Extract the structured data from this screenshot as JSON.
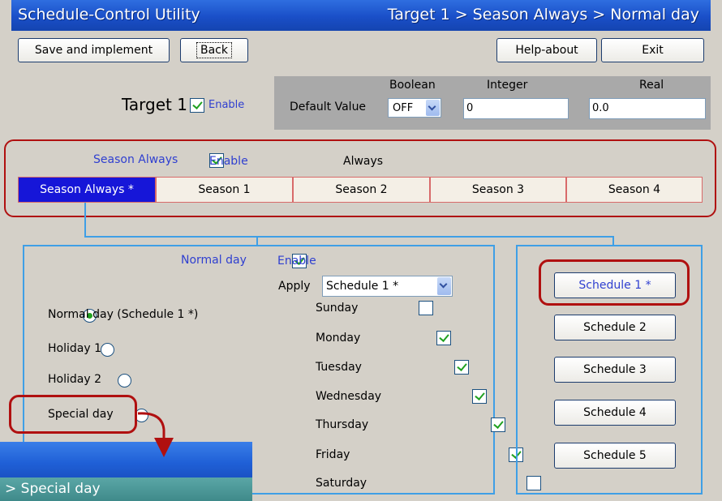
{
  "header": {
    "app_title": "Schedule-Control Utility",
    "breadcrumb": "Target 1 > Season Always > Normal day"
  },
  "toolbar": {
    "save_label": "Save and implement",
    "back_label": "Back",
    "help_label": "Help-about",
    "exit_label": "Exit"
  },
  "target": {
    "title": "Target 1",
    "enable_label": "Enable",
    "enabled": true
  },
  "default_value": {
    "label": "Default Value",
    "boolean_header": "Boolean",
    "integer_header": "Integer",
    "real_header": "Real",
    "boolean_value": "OFF",
    "integer_value": "0",
    "real_value": "0.0"
  },
  "season": {
    "name": "Season Always",
    "enable_label": "Enable",
    "enabled": true,
    "type_label": "Always",
    "tabs": [
      "Season Always *",
      "Season 1",
      "Season 2",
      "Season 3",
      "Season 4"
    ],
    "active_tab": 0
  },
  "day": {
    "name": "Normal day",
    "enable_label": "Enable",
    "enabled": true,
    "apply_label": "Apply",
    "apply_value": "Schedule 1 *",
    "day_types": [
      {
        "label": "Normal day (Schedule 1 *)",
        "selected": true
      },
      {
        "label": "Holiday 1",
        "selected": false
      },
      {
        "label": "Holiday 2",
        "selected": false
      },
      {
        "label": "Special day",
        "selected": false
      }
    ],
    "weekdays": [
      {
        "label": "Sunday",
        "checked": false
      },
      {
        "label": "Monday",
        "checked": true
      },
      {
        "label": "Tuesday",
        "checked": true
      },
      {
        "label": "Wednesday",
        "checked": true
      },
      {
        "label": "Thursday",
        "checked": true
      },
      {
        "label": "Friday",
        "checked": true
      },
      {
        "label": "Saturday",
        "checked": false
      }
    ]
  },
  "schedules": [
    "Schedule 1 *",
    "Schedule 2",
    "Schedule 3",
    "Schedule 4",
    "Schedule 5"
  ],
  "callout": {
    "breadcrumb_suffix": "> Special day"
  },
  "colors": {
    "title_bar": "#1a4fc8",
    "active_tab": "#1616d8",
    "highlight_box": "#b01010",
    "connector_lines": "#3f9fe6",
    "check_green": "#21a121"
  }
}
